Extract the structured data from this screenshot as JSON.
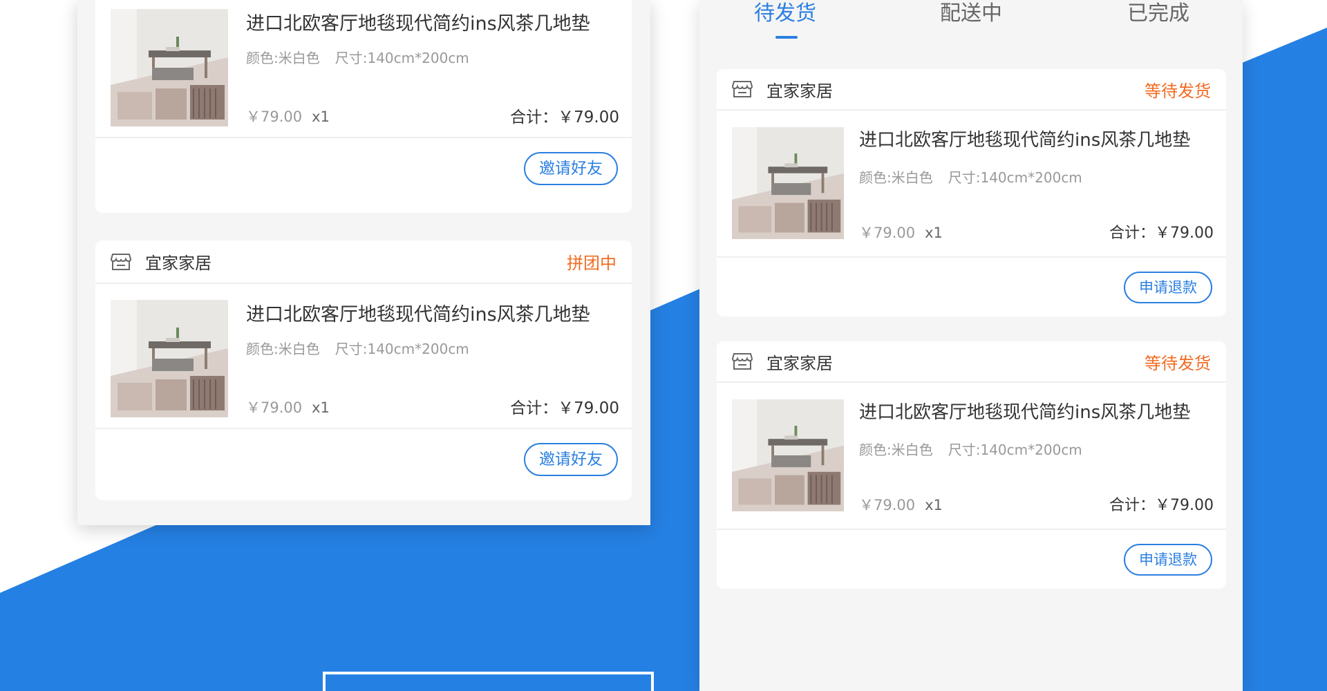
{
  "colors": {
    "accent": "#2b7fe0",
    "status_orange": "#f26b22",
    "background_blue": "#2580e3"
  },
  "left_panel": {
    "cards": [
      {
        "product": {
          "title": "进口北欧客厅地毯现代简约ins风茶几地垫",
          "color": "颜色:米白色",
          "size": "尺寸:140cm*200cm",
          "price": "￥79.00",
          "qty": "x1",
          "total": "合计：￥79.00"
        },
        "action": "邀请好友"
      },
      {
        "store": "宜家家居",
        "status": "拼团中",
        "product": {
          "title": "进口北欧客厅地毯现代简约ins风茶几地垫",
          "color": "颜色:米白色",
          "size": "尺寸:140cm*200cm",
          "price": "￥79.00",
          "qty": "x1",
          "total": "合计：￥79.00"
        },
        "action": "邀请好友"
      }
    ]
  },
  "right_panel": {
    "tabs": [
      {
        "label": "待发货",
        "active": true
      },
      {
        "label": "配送中",
        "active": false
      },
      {
        "label": "已完成",
        "active": false
      }
    ],
    "cards": [
      {
        "store": "宜家家居",
        "status": "等待发货",
        "product": {
          "title": "进口北欧客厅地毯现代简约ins风茶几地垫",
          "color": "颜色:米白色",
          "size": "尺寸:140cm*200cm",
          "price": "￥79.00",
          "qty": "x1",
          "total": "合计：￥79.00"
        },
        "action": "申请退款"
      },
      {
        "store": "宜家家居",
        "status": "等待发货",
        "product": {
          "title": "进口北欧客厅地毯现代简约ins风茶几地垫",
          "color": "颜色:米白色",
          "size": "尺寸:140cm*200cm",
          "price": "￥79.00",
          "qty": "x1",
          "total": "合计：￥79.00"
        },
        "action": "申请退款"
      }
    ]
  }
}
